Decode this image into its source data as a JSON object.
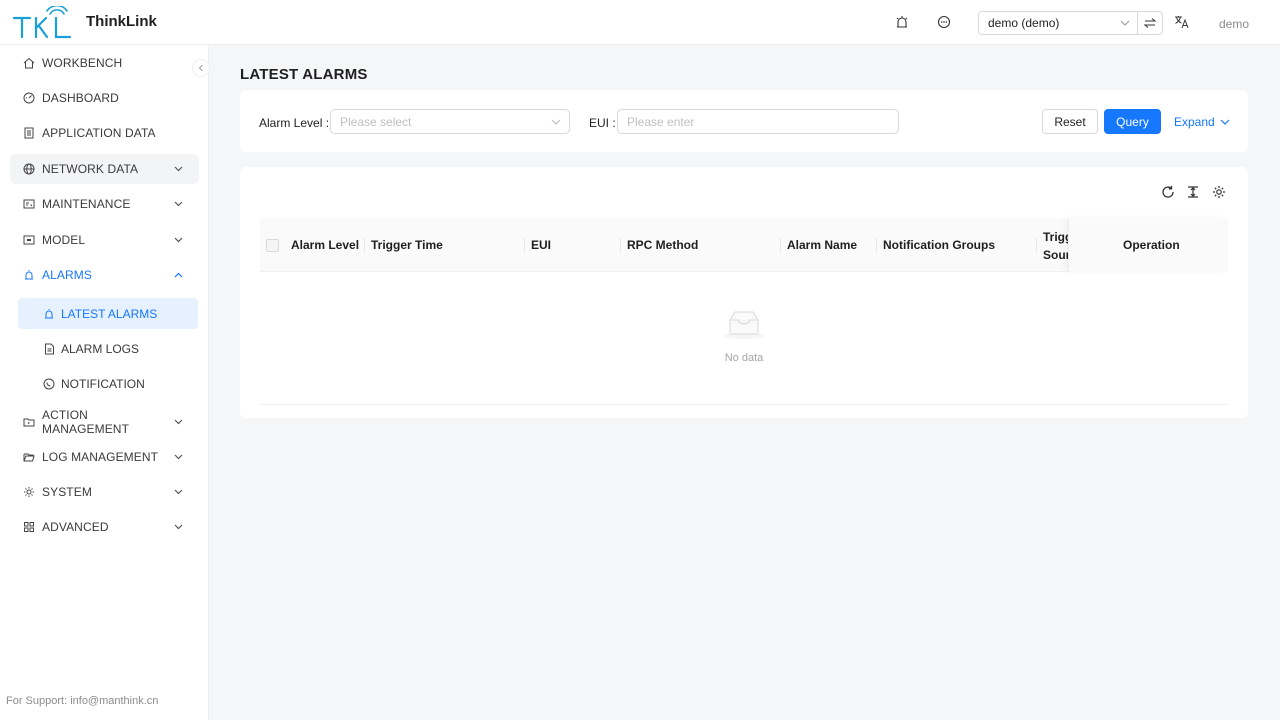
{
  "header": {
    "logo_text": "TKL",
    "app_name": "ThinkLink",
    "org_select": "demo (demo)",
    "user": "demo",
    "icons": [
      "alarm-icon",
      "message-icon",
      "swap-icon",
      "translate-icon"
    ]
  },
  "sidebar": {
    "items": [
      {
        "label": "WORKBENCH",
        "icon": "home-icon"
      },
      {
        "label": "DASHBOARD",
        "icon": "dashboard-icon"
      },
      {
        "label": "APPLICATION DATA",
        "icon": "document-icon"
      },
      {
        "label": "NETWORK DATA",
        "icon": "globe-icon"
      },
      {
        "label": "MAINTENANCE",
        "icon": "maintenance-icon"
      },
      {
        "label": "MODEL",
        "icon": "model-icon"
      },
      {
        "label": "ALARMS",
        "icon": "alarm-icon"
      },
      {
        "label": "ACTION MANAGEMENT",
        "icon": "folder-icon"
      },
      {
        "label": "LOG MANAGEMENT",
        "icon": "folder-open-icon"
      },
      {
        "label": "SYSTEM",
        "icon": "gear-icon"
      },
      {
        "label": "ADVANCED",
        "icon": "grid-icon"
      }
    ],
    "alarm_sub": [
      {
        "label": "LATEST ALARMS",
        "icon": "alarm-icon"
      },
      {
        "label": "ALARM LOGS",
        "icon": "file-icon"
      },
      {
        "label": "NOTIFICATION",
        "icon": "whatsapp-icon"
      }
    ],
    "support": "For Support: info@manthink.cn"
  },
  "main": {
    "title": "LATEST ALARMS",
    "search": {
      "alarm_level_label": "Alarm Level",
      "alarm_level_placeholder": "Please select",
      "eui_label": "EUI",
      "eui_placeholder": "Please enter",
      "reset": "Reset",
      "query": "Query",
      "expand": "Expand"
    },
    "table": {
      "columns": [
        "Alarm Level",
        "Trigger Time",
        "EUI",
        "RPC Method",
        "Alarm Name",
        "Notification Groups",
        "Trigger Source",
        "Operation"
      ],
      "trigger_line1": "Trigg",
      "trigger_line2": "Sour",
      "empty_text": "No data"
    }
  },
  "colors": {
    "accent": "#1677ff",
    "logo": "#1a9fd9"
  }
}
